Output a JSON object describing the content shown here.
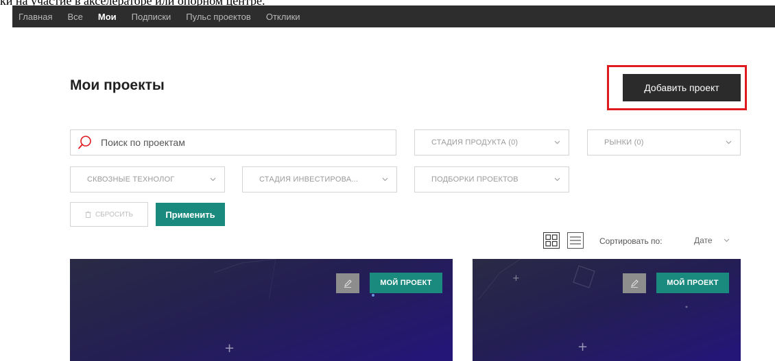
{
  "caption": "ки на участие в акселераторе или опорном центре.",
  "nav": {
    "items": [
      {
        "label": "Главная",
        "active": false
      },
      {
        "label": "Все",
        "active": false
      },
      {
        "label": "Мои",
        "active": true
      },
      {
        "label": "Подписки",
        "active": false
      },
      {
        "label": "Пульс проектов",
        "active": false
      },
      {
        "label": "Отклики",
        "active": false
      }
    ]
  },
  "page": {
    "title": "Мои проекты",
    "add_button": "Добавить проект"
  },
  "search": {
    "placeholder": "Поиск по проектам",
    "value": ""
  },
  "filters": {
    "product_stage": "СТАДИЯ ПРОДУКТА (0)",
    "markets": "РЫНКИ (0)",
    "technologies": "СКВОЗНЫЕ ТЕХНОЛОГ",
    "investment_stage": "СТАДИЯ ИНВЕСТИРОВА...",
    "collections": "ПОДБОРКИ ПРОЕКТОВ"
  },
  "actions": {
    "reset": "СБРОСИТЬ",
    "apply": "Применить"
  },
  "sort": {
    "label": "Сортировать по:",
    "value": "Дате"
  },
  "cards": [
    {
      "badge": "МОЙ ПРОЕКТ"
    },
    {
      "badge": "МОЙ ПРОЕКТ"
    }
  ],
  "icons": {
    "search": "search-icon",
    "chevron": "chevron-down-icon",
    "trash": "trash-icon",
    "grid": "grid-view-icon",
    "list": "list-view-icon",
    "edit": "pencil-icon"
  },
  "colors": {
    "nav_bg": "#2d2d2d",
    "accent": "#1b8a7e",
    "highlight": "#e0191f",
    "search_icon": "#e0191f",
    "button_dark": "#2b2b2b"
  }
}
